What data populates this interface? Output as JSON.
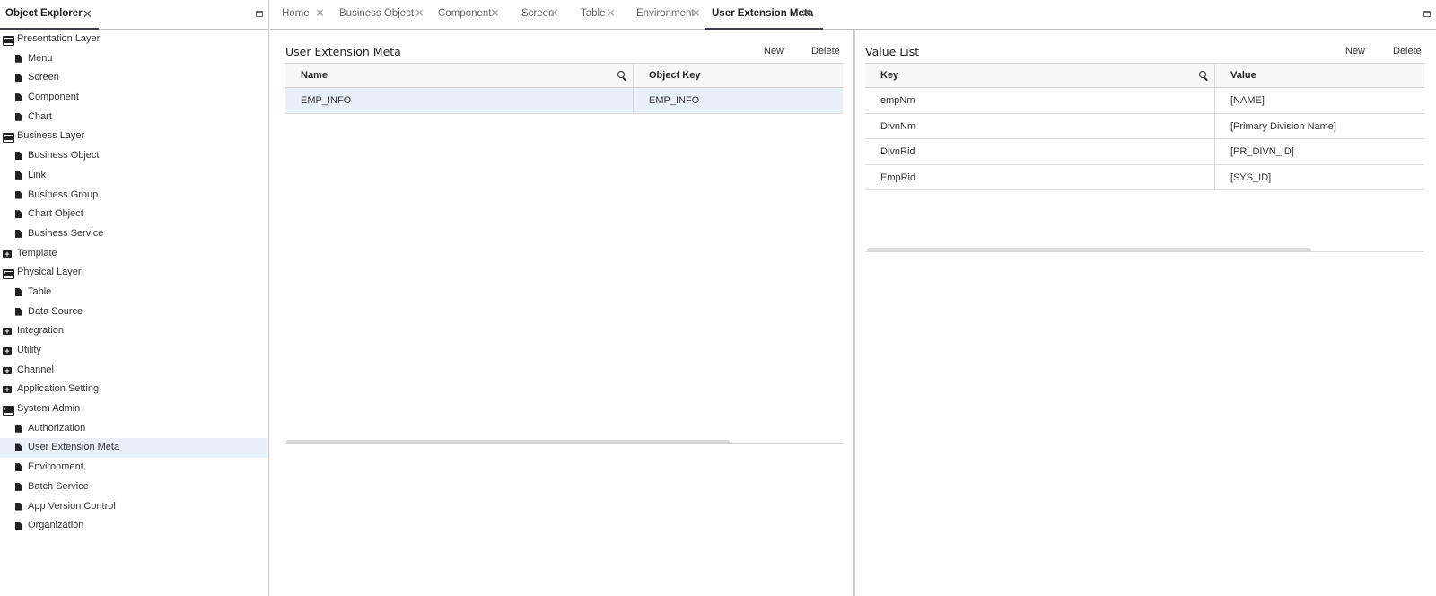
{
  "explorer": {
    "title": "Object Explorer",
    "close_glyph": "✕",
    "maximize_icon": "maximize-icon",
    "tree": [
      {
        "label": "Presentation Layer",
        "level": 0,
        "icon": "folder-open-icon"
      },
      {
        "label": "Menu",
        "level": 1,
        "icon": "file-icon"
      },
      {
        "label": "Screen",
        "level": 1,
        "icon": "file-icon"
      },
      {
        "label": "Component",
        "level": 1,
        "icon": "file-icon"
      },
      {
        "label": "Chart",
        "level": 1,
        "icon": "file-icon"
      },
      {
        "label": "Business Layer",
        "level": 0,
        "icon": "folder-open-icon"
      },
      {
        "label": "Business Object",
        "level": 1,
        "icon": "file-icon"
      },
      {
        "label": "Link",
        "level": 1,
        "icon": "file-icon"
      },
      {
        "label": "Business Group",
        "level": 1,
        "icon": "file-icon"
      },
      {
        "label": "Chart Object",
        "level": 1,
        "icon": "file-icon"
      },
      {
        "label": "Business Service",
        "level": 1,
        "icon": "file-icon"
      },
      {
        "label": "Template",
        "level": 0,
        "icon": "folder-plus-icon"
      },
      {
        "label": "Physical Layer",
        "level": 0,
        "icon": "folder-open-icon"
      },
      {
        "label": "Table",
        "level": 1,
        "icon": "file-icon"
      },
      {
        "label": "Data Source",
        "level": 1,
        "icon": "file-icon"
      },
      {
        "label": "Integration",
        "level": 0,
        "icon": "folder-plus-icon"
      },
      {
        "label": "Utility",
        "level": 0,
        "icon": "folder-plus-icon"
      },
      {
        "label": "Channel",
        "level": 0,
        "icon": "folder-plus-icon"
      },
      {
        "label": "Application Setting",
        "level": 0,
        "icon": "folder-plus-icon"
      },
      {
        "label": "System Admin",
        "level": 0,
        "icon": "folder-open-icon"
      },
      {
        "label": "Authorization",
        "level": 1,
        "icon": "file-icon"
      },
      {
        "label": "User Extension Meta",
        "level": 1,
        "icon": "file-icon",
        "selected": true
      },
      {
        "label": "Environment",
        "level": 1,
        "icon": "file-icon"
      },
      {
        "label": "Batch Service",
        "level": 1,
        "icon": "file-icon"
      },
      {
        "label": "App Version Control",
        "level": 1,
        "icon": "file-icon"
      },
      {
        "label": "Organization",
        "level": 1,
        "icon": "file-icon"
      }
    ]
  },
  "tabs": {
    "close_glyph": "✕",
    "items": [
      {
        "label": "Home"
      },
      {
        "label": "Business Object"
      },
      {
        "label": "Component"
      },
      {
        "label": "Screen"
      },
      {
        "label": "Table"
      },
      {
        "label": "Environment"
      },
      {
        "label": "User Extension Meta",
        "active": true
      }
    ]
  },
  "meta_panel": {
    "title": "User Extension Meta",
    "new_label": "New",
    "delete_label": "Delete",
    "columns": [
      "Name",
      "Object Key"
    ],
    "rows": [
      {
        "name": "EMP_INFO",
        "object_key": "EMP_INFO",
        "selected": true
      }
    ]
  },
  "value_panel": {
    "title": "Value List",
    "new_label": "New",
    "delete_label": "Delete",
    "columns": [
      "Key",
      "Value"
    ],
    "rows": [
      {
        "key": "empNm",
        "value": "[NAME]"
      },
      {
        "key": "DivnNm",
        "value": "[Primary Division Name]"
      },
      {
        "key": "DivnRid",
        "value": "[PR_DIVN_ID]"
      },
      {
        "key": "EmpRid",
        "value": "[SYS_ID]"
      }
    ]
  },
  "colors": {
    "accent_underline": "#3a3f4a",
    "selected_row": "#e8f0fa"
  }
}
